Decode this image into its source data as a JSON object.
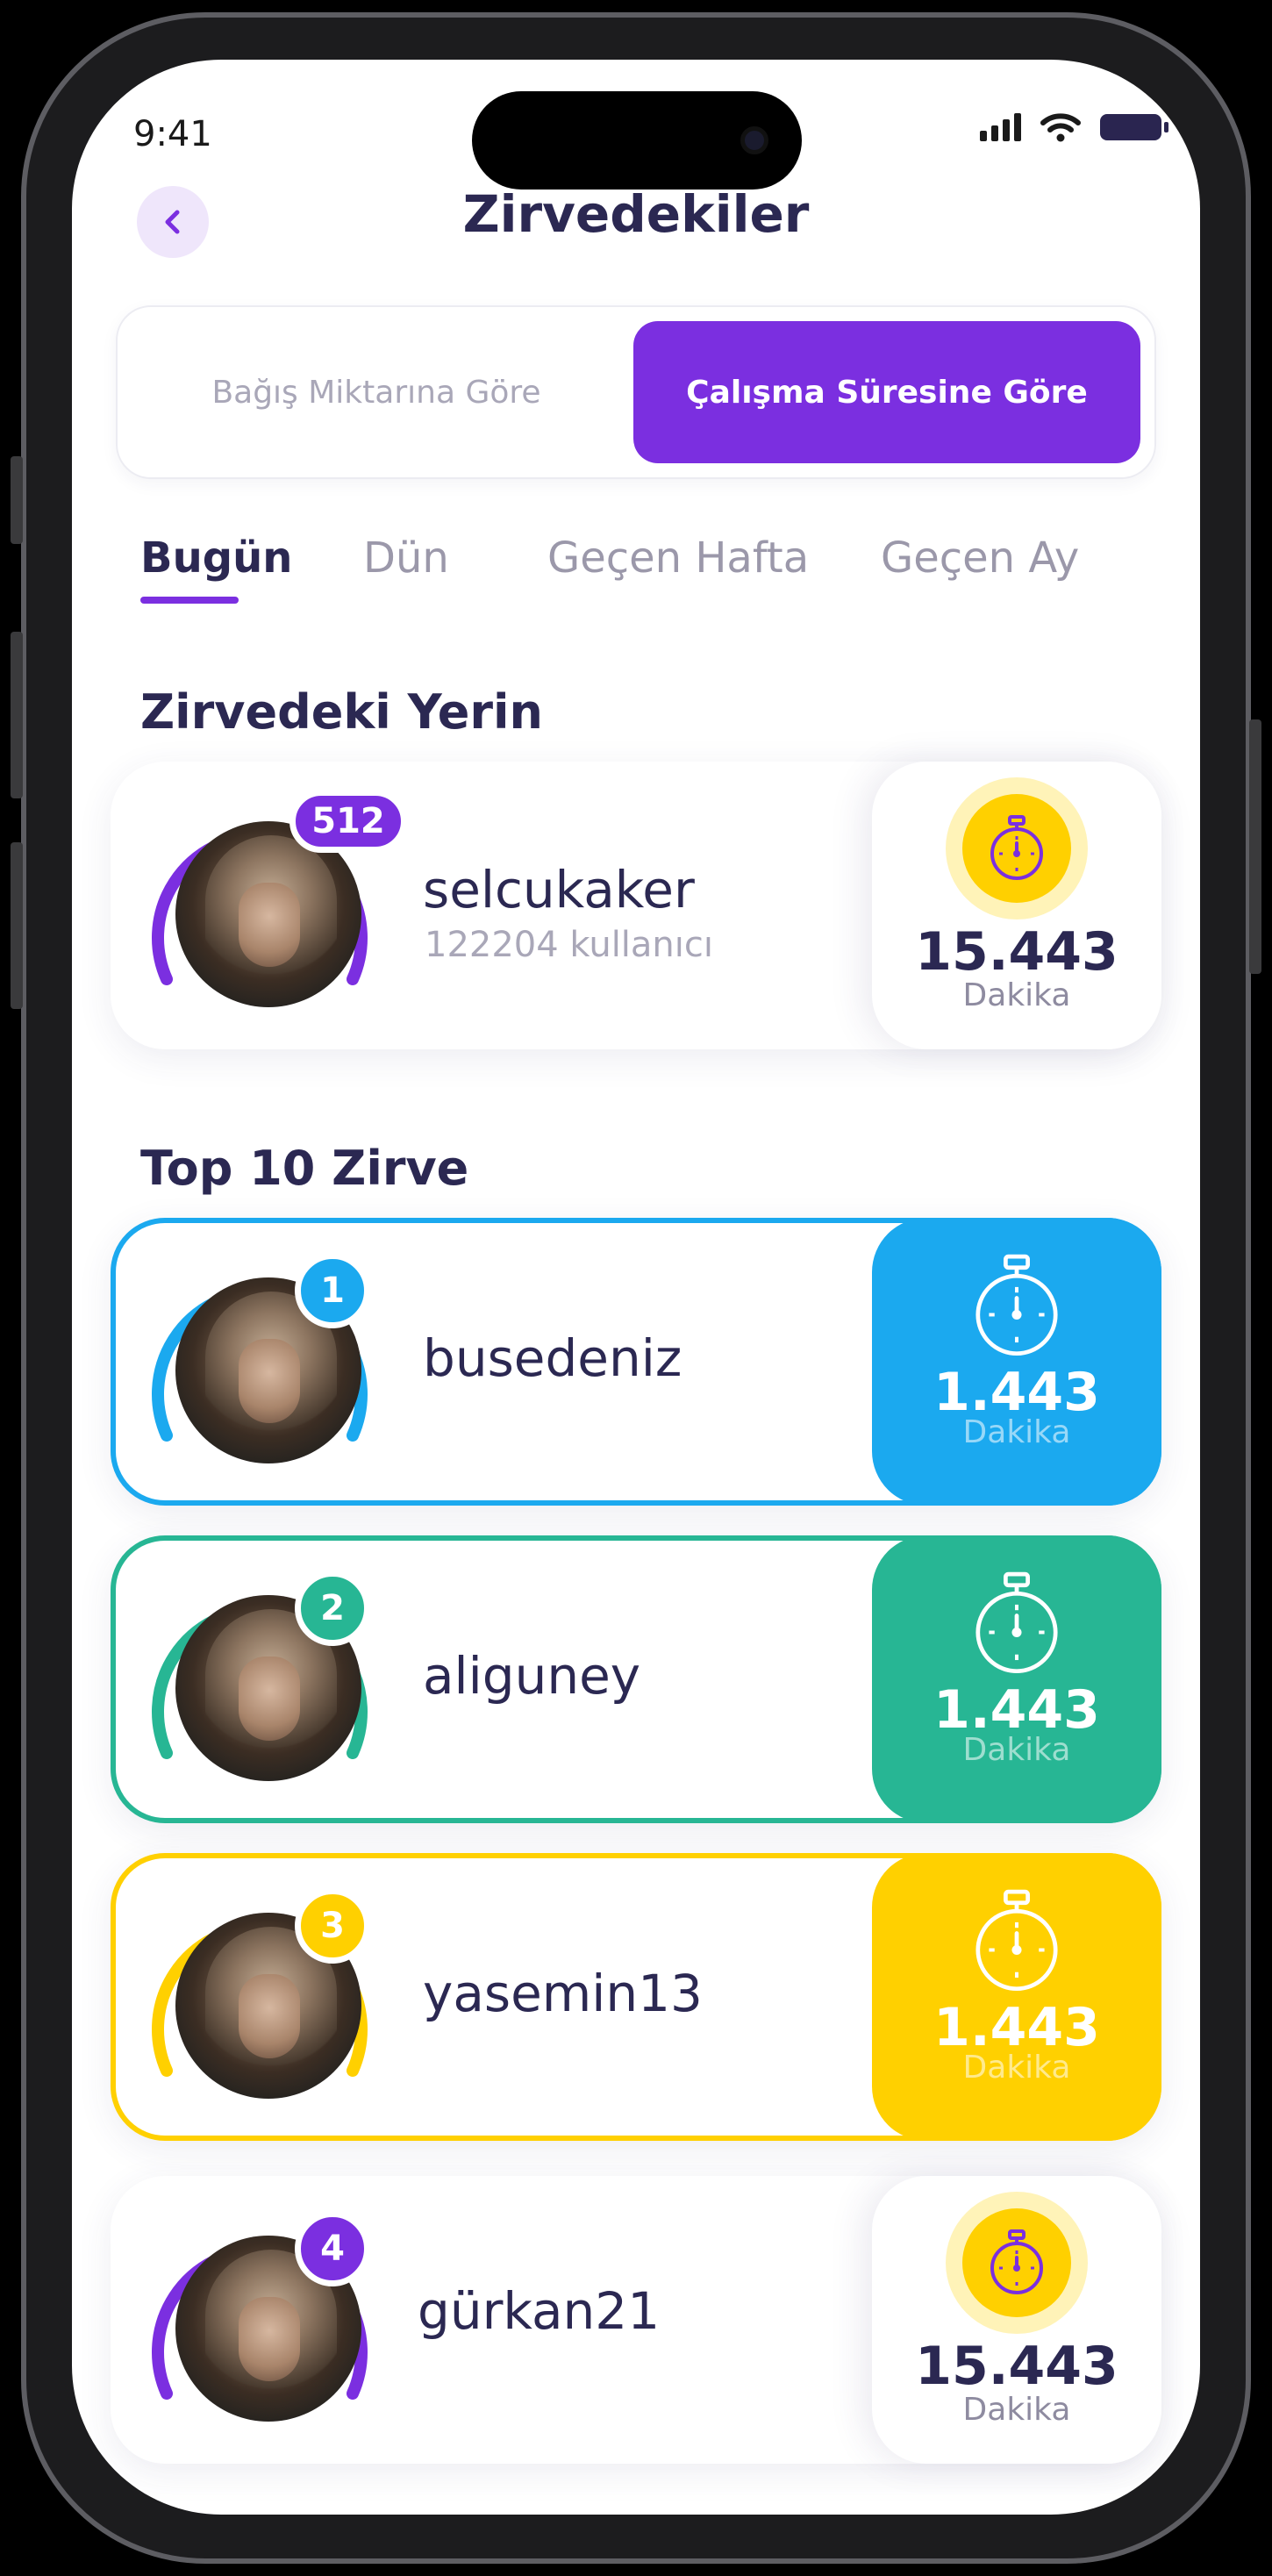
{
  "status_bar": {
    "time": "9:41"
  },
  "header": {
    "title": "Zirvedekiler"
  },
  "segments": {
    "left": "Bağış Miktarına Göre",
    "right": "Çalışma Süresine Göre",
    "active": "right"
  },
  "tabs": [
    {
      "label": "Bugün",
      "active": true
    },
    {
      "label": "Dün",
      "active": false
    },
    {
      "label": "Geçen Hafta",
      "active": false
    },
    {
      "label": "Geçen Ay",
      "active": false
    }
  ],
  "my_rank": {
    "section_title": "Zirvedeki Yerin",
    "rank": "512",
    "username": "selcukaker",
    "subtitle": "122204 kullanıcı",
    "value": "15.443",
    "unit": "Dakika",
    "color": "#7b2fe0"
  },
  "top10": {
    "section_title": "Top 10 Zirve",
    "entries": [
      {
        "rank": "1",
        "username": "busedeniz",
        "value": "1.443",
        "unit": "Dakika",
        "color": "#1ba9ef"
      },
      {
        "rank": "2",
        "username": "aliguney",
        "value": "1.443",
        "unit": "Dakika",
        "color": "#27b694"
      },
      {
        "rank": "3",
        "username": "yasemin13",
        "value": "1.443",
        "unit": "Dakika",
        "color": "#ffd000"
      },
      {
        "rank": "4",
        "username": "gürkan21",
        "value": "15.443",
        "unit": "Dakika",
        "color": "#7b2fe0"
      }
    ]
  },
  "icons": [
    "back-chevron-icon",
    "signal-icon",
    "wifi-icon",
    "battery-icon",
    "stopwatch-icon"
  ]
}
